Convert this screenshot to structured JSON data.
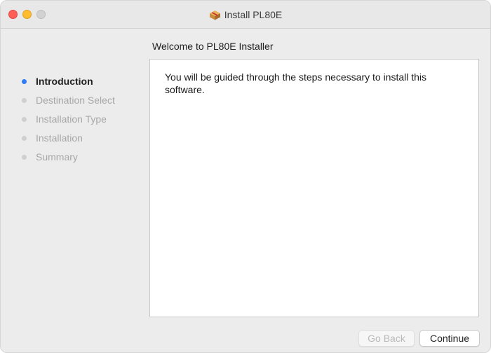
{
  "window": {
    "title": "Install PL80E",
    "title_icon": "package-icon"
  },
  "heading": "Welcome to PL80E Installer",
  "sidebar": {
    "items": [
      {
        "label": "Introduction",
        "state": "active"
      },
      {
        "label": "Destination Select",
        "state": "inactive"
      },
      {
        "label": "Installation Type",
        "state": "inactive"
      },
      {
        "label": "Installation",
        "state": "inactive"
      },
      {
        "label": "Summary",
        "state": "inactive"
      }
    ]
  },
  "content": {
    "text": "You will be guided through the steps necessary to install this software."
  },
  "buttons": {
    "back_label": "Go Back",
    "back_enabled": false,
    "continue_label": "Continue"
  },
  "colors": {
    "close": "#fe5f57",
    "minimize": "#febc2e",
    "zoom_inactive": "#d2d2d2",
    "active_step_dot": "#2f7cf6",
    "inactive_step_text": "#a7a7a7"
  }
}
